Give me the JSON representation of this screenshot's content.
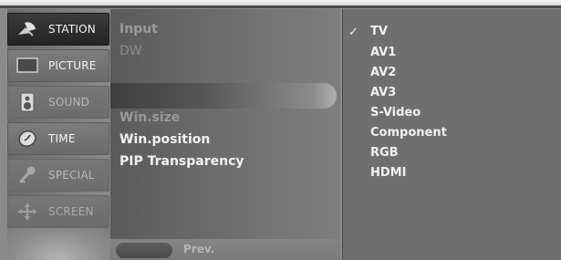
{
  "categories": [
    {
      "label": "STATION",
      "icon": "satellite-dish-icon",
      "state": "active"
    },
    {
      "label": "PICTURE",
      "icon": "monitor-icon",
      "state": "normal"
    },
    {
      "label": "SOUND",
      "icon": "speaker-icon",
      "state": "dim"
    },
    {
      "label": "TIME",
      "icon": "clock-icon",
      "state": "normal"
    },
    {
      "label": "SPECIAL",
      "icon": "key-icon",
      "state": "dim"
    },
    {
      "label": "SCREEN",
      "icon": "screen-move-icon",
      "state": "faded"
    }
  ],
  "submenu": {
    "items": [
      "Input",
      "DW",
      "Win.size",
      "Win.position",
      "PIP Transparency"
    ],
    "prev_label": "Prev."
  },
  "options": {
    "selected": "TV",
    "checkmark": "✓",
    "items": [
      "TV",
      "AV1",
      "AV2",
      "AV3",
      "S-Video",
      "Component",
      "RGB",
      "HDMI"
    ]
  }
}
